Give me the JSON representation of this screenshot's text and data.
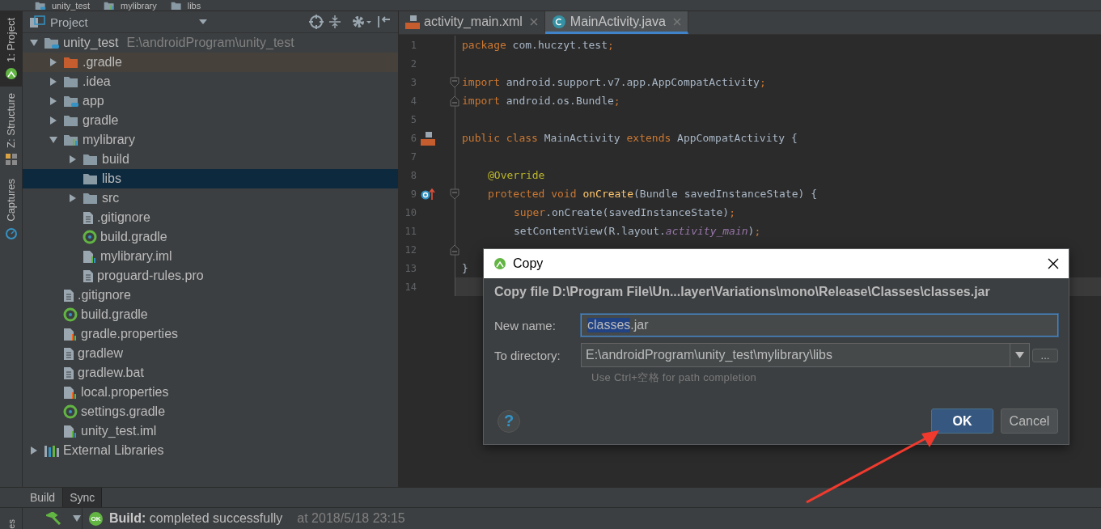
{
  "breadcrumbs": [
    {
      "label": "unity_test",
      "kind": "module"
    },
    {
      "label": "mylibrary",
      "kind": "library"
    },
    {
      "label": "libs",
      "kind": "folder"
    }
  ],
  "left_strip": [
    {
      "label": "1: Project",
      "selected": true,
      "kind": "android"
    },
    {
      "label": "Z: Structure",
      "selected": false,
      "kind": "structure"
    },
    {
      "label": "Captures",
      "selected": false,
      "kind": "captures"
    }
  ],
  "left_strip_bottom": {
    "label": "es"
  },
  "project_panel": {
    "title": "Project",
    "tree": [
      {
        "label": "unity_test",
        "hint": "E:\\androidProgram\\unity_test",
        "kind": "module",
        "expanded": true,
        "selected": false,
        "children": [
          {
            "label": ".gradle",
            "kind": "excluded",
            "expanded": false,
            "selected": false
          },
          {
            "label": ".idea",
            "kind": "folder",
            "expanded": false,
            "selected": false
          },
          {
            "label": "app",
            "kind": "module",
            "expanded": false,
            "selected": false
          },
          {
            "label": "gradle",
            "kind": "folder",
            "expanded": false,
            "selected": false
          },
          {
            "label": "mylibrary",
            "kind": "library",
            "expanded": true,
            "selected": false,
            "children": [
              {
                "label": "build",
                "kind": "folder",
                "expanded": false,
                "selected": false
              },
              {
                "label": "libs",
                "kind": "folder",
                "selected": true
              },
              {
                "label": "src",
                "kind": "folder",
                "expanded": false,
                "selected": false
              },
              {
                "label": ".gitignore",
                "kind": "file",
                "selected": false
              },
              {
                "label": "build.gradle",
                "kind": "gradle",
                "selected": false
              },
              {
                "label": "mylibrary.iml",
                "kind": "iml",
                "selected": false
              },
              {
                "label": "proguard-rules.pro",
                "kind": "file",
                "selected": false
              }
            ]
          },
          {
            "label": ".gitignore",
            "kind": "file",
            "selected": false
          },
          {
            "label": "build.gradle",
            "kind": "gradle",
            "selected": false
          },
          {
            "label": "gradle.properties",
            "kind": "props",
            "selected": false
          },
          {
            "label": "gradlew",
            "kind": "file",
            "selected": false
          },
          {
            "label": "gradlew.bat",
            "kind": "file",
            "selected": false
          },
          {
            "label": "local.properties",
            "kind": "props",
            "selected": false
          },
          {
            "label": "settings.gradle",
            "kind": "gradle",
            "selected": false
          },
          {
            "label": "unity_test.iml",
            "kind": "iml",
            "selected": false
          }
        ]
      },
      {
        "label": "External Libraries",
        "kind": "extlib",
        "expanded": false,
        "selected": false
      }
    ]
  },
  "editor_tabs": [
    {
      "label": "activity_main.xml",
      "kind": "xml",
      "selected": false
    },
    {
      "label": "MainActivity.java",
      "kind": "class",
      "selected": true
    }
  ],
  "code_lines": [
    {
      "number": "1",
      "segments": [
        {
          "text": "package",
          "kind": "keyword"
        },
        {
          "text": " com.huczyt.test",
          "kind": "plain"
        },
        {
          "text": ";",
          "kind": "keyword"
        }
      ]
    },
    {
      "number": "2"
    },
    {
      "number": "3",
      "fold_start": true,
      "segments": [
        {
          "text": "import",
          "kind": "keyword"
        },
        {
          "text": " android.support.v7.app.AppCompatActivity",
          "kind": "plain"
        },
        {
          "text": ";",
          "kind": "keyword"
        }
      ]
    },
    {
      "number": "4",
      "fold_end": true,
      "segments": [
        {
          "text": "import",
          "kind": "keyword"
        },
        {
          "text": " android.os.Bundle",
          "kind": "plain"
        },
        {
          "text": ";",
          "kind": "keyword"
        }
      ]
    },
    {
      "number": "5"
    },
    {
      "number": "6",
      "layout_marker": true,
      "segments": [
        {
          "text": "public class",
          "kind": "keyword"
        },
        {
          "text": " MainActivity ",
          "kind": "plain"
        },
        {
          "text": "extends",
          "kind": "keyword"
        },
        {
          "text": " AppCompatActivity {",
          "kind": "plain"
        }
      ]
    },
    {
      "number": "7"
    },
    {
      "number": "8",
      "in_class": true,
      "segments": [
        {
          "text": "@Override",
          "kind": "annotation"
        }
      ]
    },
    {
      "number": "9",
      "in_class": true,
      "override_marker": true,
      "fold_start": true,
      "segments": [
        {
          "text": "protected void ",
          "kind": "keyword"
        },
        {
          "text": "onCreate",
          "kind": "method"
        },
        {
          "text": "(Bundle savedInstanceState) {",
          "kind": "plain"
        }
      ]
    },
    {
      "number": "10",
      "in_class": true,
      "in_method": true,
      "segments": [
        {
          "text": "super",
          "kind": "keyword"
        },
        {
          "text": ".onCreate(savedInstanceState)",
          "kind": "plain"
        },
        {
          "text": ";",
          "kind": "keyword"
        }
      ]
    },
    {
      "number": "11",
      "in_class": true,
      "in_method": true,
      "segments": [
        {
          "text": "setContentView(R.layout.",
          "kind": "plain"
        },
        {
          "text": "activity_main",
          "kind": "field"
        },
        {
          "text": ")",
          "kind": "plain"
        },
        {
          "text": ";",
          "kind": "keyword"
        }
      ]
    },
    {
      "number": "12",
      "fold_end": true
    },
    {
      "number": "13",
      "segments": [
        {
          "text": "}",
          "kind": "plain"
        }
      ]
    },
    {
      "number": "14",
      "current": true
    }
  ],
  "dialog": {
    "title": "Copy",
    "message": "Copy file D:\\Program File\\Un...layer\\Variations\\mono\\Release\\Classes\\classes.jar",
    "new_name": {
      "label": "New name:",
      "value_selected": "classes",
      "value_rest": ".jar"
    },
    "to_directory": {
      "label": "To directory:",
      "value": "E:\\androidProgram\\unity_test\\mylibrary\\libs",
      "browse": "...",
      "hint": "Use Ctrl+空格 for path completion"
    },
    "help": "?",
    "buttons": [
      {
        "label": "OK",
        "default": true
      },
      {
        "label": "Cancel",
        "default": false
      }
    ]
  },
  "bottom_tabs": [
    {
      "label": "Build",
      "selected": false
    },
    {
      "label": "Sync",
      "selected": true
    }
  ],
  "build_status": {
    "expanded": true,
    "badge": "OK",
    "message": "**Build:** completed successfully",
    "time": "at 2018/5/18 23:15"
  }
}
